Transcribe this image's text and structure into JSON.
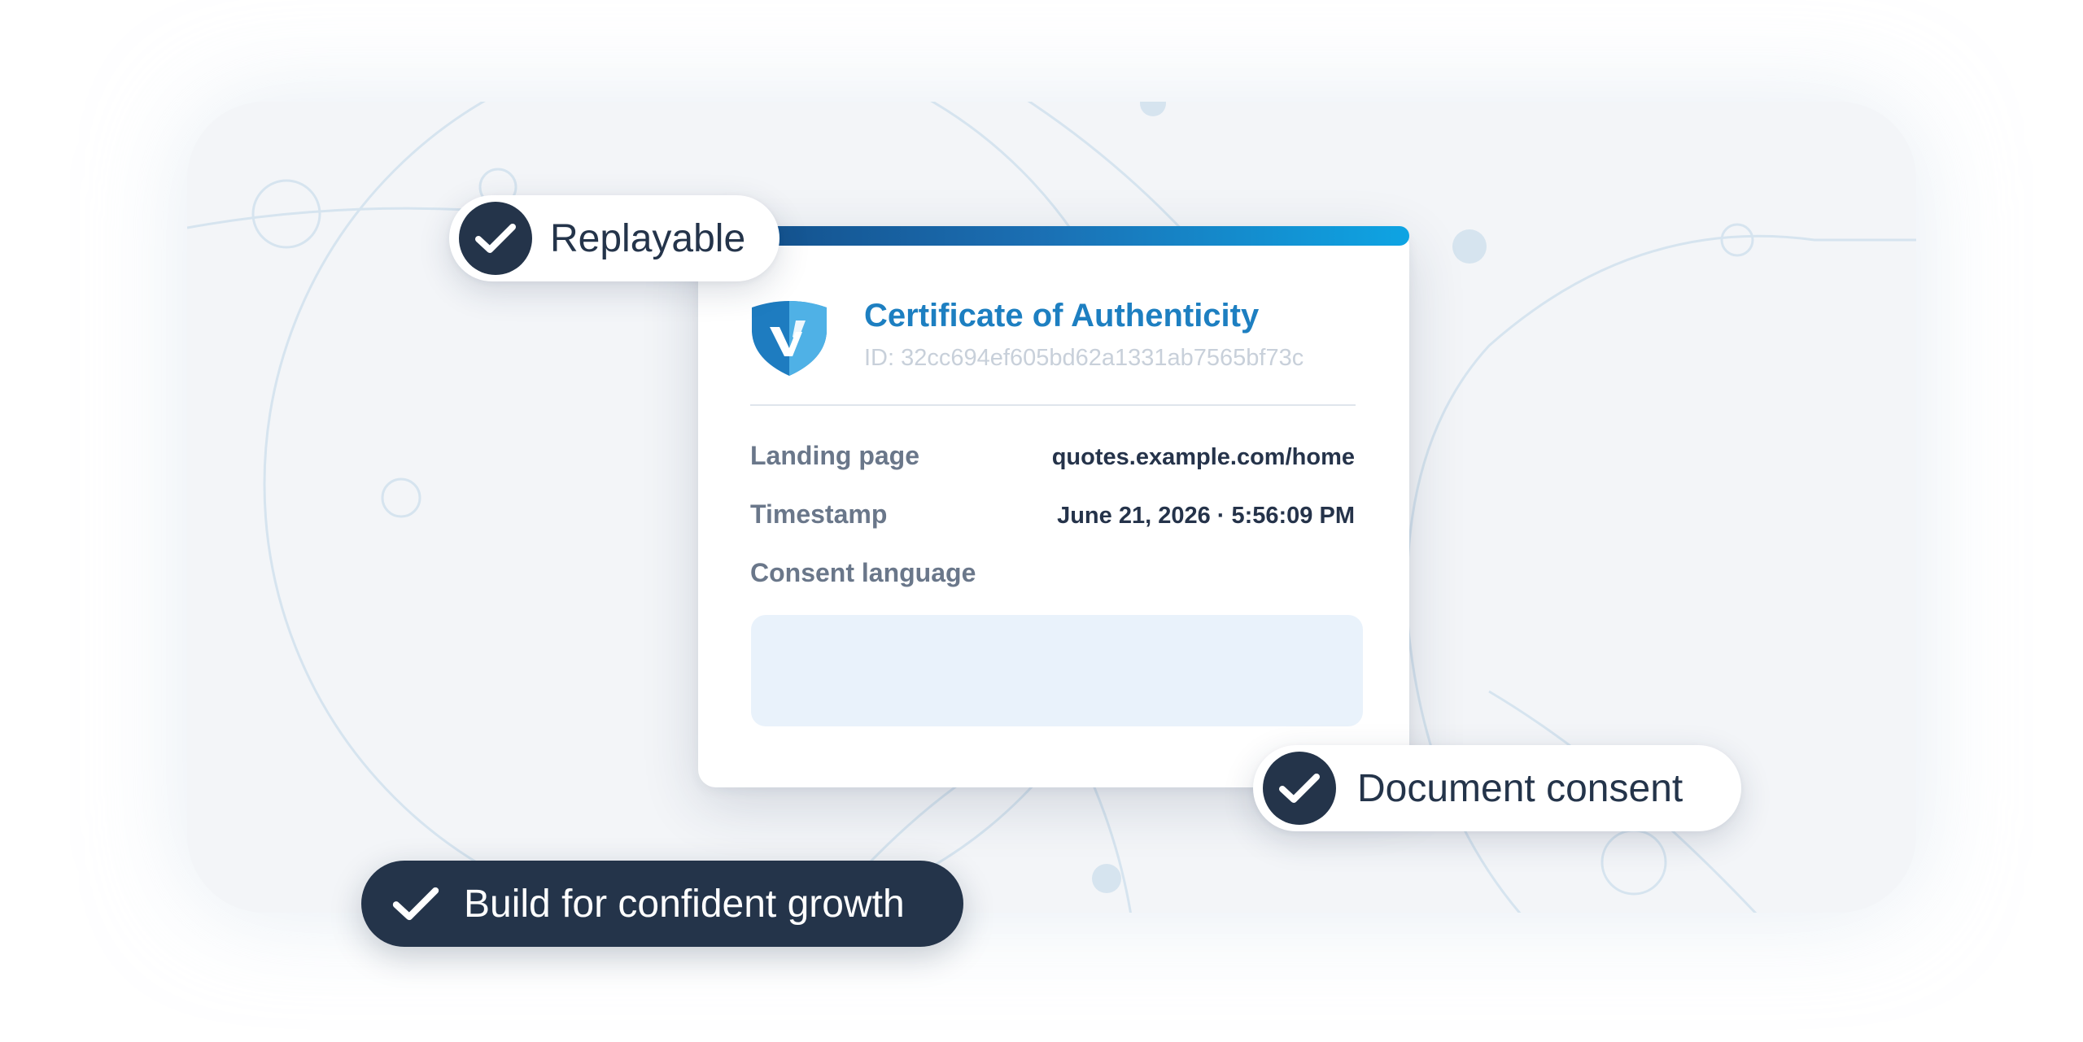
{
  "badges": {
    "replayable": "Replayable",
    "document_consent": "Document consent",
    "growth": "Build for confident growth",
    "check_icon": "check-icon"
  },
  "certificate": {
    "title": "Certificate of Authenticity",
    "id": "ID: 32cc694ef605bd62a1331ab7565bf73c",
    "logo_icon": "shield-check-logo",
    "rows": [
      {
        "label": "Landing page",
        "value": "quotes.example.com/home"
      },
      {
        "label": "Timestamp",
        "value": "June 21, 2026 · 5:56:09 PM"
      },
      {
        "label": "Consent language",
        "value": ""
      }
    ]
  },
  "colors": {
    "brand_blue": "#1d7fc1",
    "navy": "#24344a",
    "panel_bg": "#f3f5f8",
    "consent_box": "#e9f2fb"
  }
}
